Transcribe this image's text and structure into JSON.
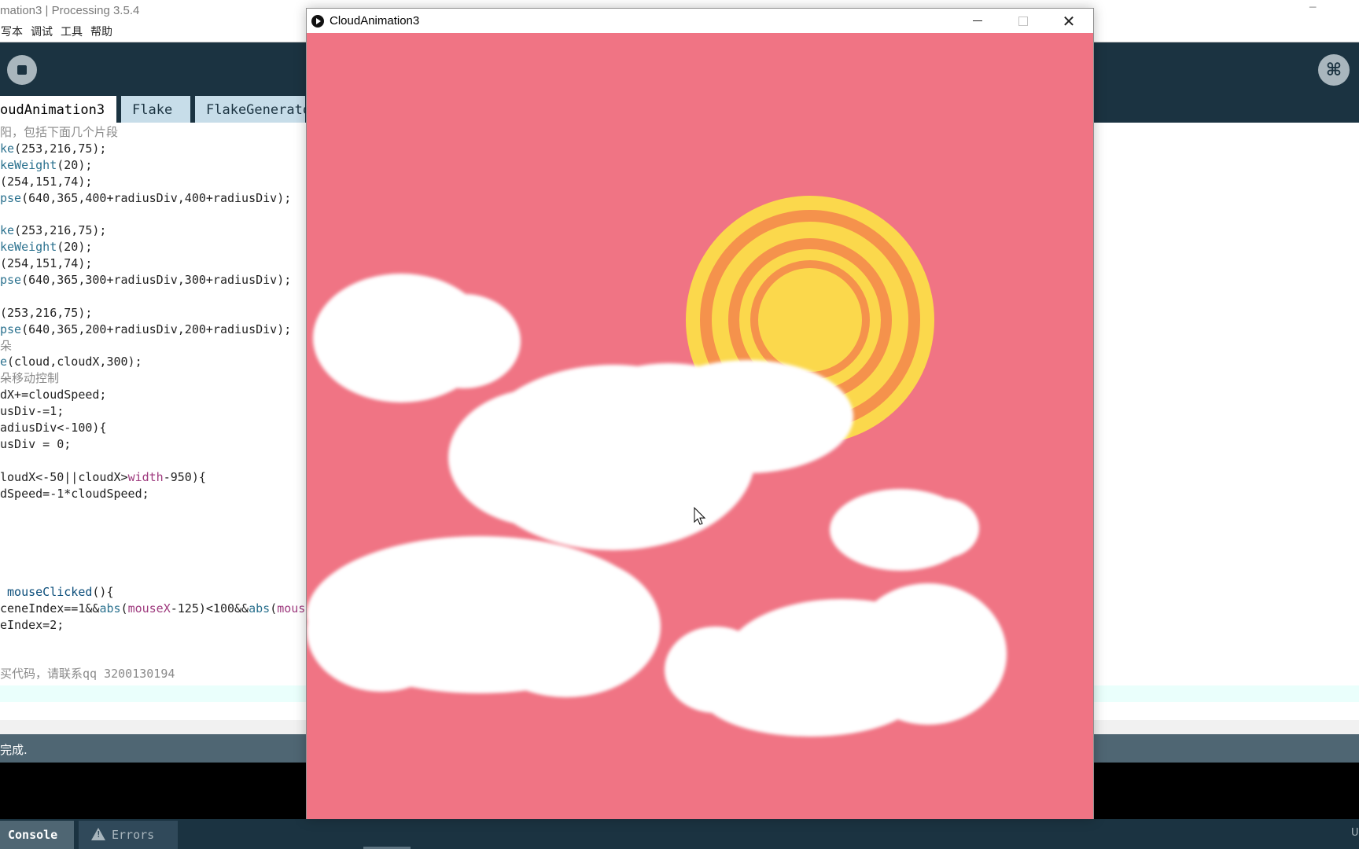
{
  "ide": {
    "window_title": "mation3 | Processing 3.5.4",
    "menu": [
      "写本",
      "调试",
      "工具",
      "帮助"
    ],
    "tabs": [
      "oudAnimation3",
      "Flake",
      "FlakeGenerato"
    ],
    "code_lines": [
      [
        "cm:阳，包括下面几个片段"
      ],
      [
        "fn:ke",
        "t:(253,216,75);"
      ],
      [
        "fn:keWeight",
        "t:(20);"
      ],
      [
        "t:(254,151,74);"
      ],
      [
        "fn:pse",
        "t:(640,365,400+radiusDiv,400+radiusDiv);"
      ],
      [],
      [
        "fn:ke",
        "t:(253,216,75);"
      ],
      [
        "fn:keWeight",
        "t:(20);"
      ],
      [
        "t:(254,151,74);"
      ],
      [
        "fn:pse",
        "t:(640,365,300+radiusDiv,300+radiusDiv);"
      ],
      [],
      [
        "t:(253,216,75);"
      ],
      [
        "fn:pse",
        "t:(640,365,200+radiusDiv,200+radiusDiv);"
      ],
      [
        "cm:朵"
      ],
      [
        "fn:e",
        "t:(cloud,cloudX,300);"
      ],
      [
        "cm:朵移动控制"
      ],
      [
        "t:dX+=cloudSpeed;"
      ],
      [
        "t:usDiv-=1;"
      ],
      [
        "t:adiusDiv<-100){"
      ],
      [
        "t:usDiv = 0;"
      ],
      [],
      [
        "t:loudX<-50||cloudX>",
        "kw:width",
        "t:-950){"
      ],
      [
        "t:dSpeed=-1*cloudSpeed;"
      ],
      [],
      [],
      [],
      [],
      [],
      [
        "md: mouseClicked",
        "t:(){"
      ],
      [
        "t:ceneIndex==1&&",
        "fn:abs",
        "t:(",
        "kw:mouseX",
        "t:-125)<100&&",
        "fn:abs",
        "t:(",
        "kw:mous"
      ],
      [
        "t:eIndex=2;"
      ],
      [],
      [],
      [
        "cm:买代码，请联系qq 3200130194"
      ]
    ],
    "status": "完成.",
    "console_tab": "Console",
    "errors_tab": "Errors",
    "bottom_right": "U"
  },
  "sketch": {
    "window_title": "CloudAnimation3",
    "min_label": "─",
    "close_label": "✕",
    "background_color": "#f07484",
    "sun_colors": [
      "#fbd84c",
      "#f5924c"
    ],
    "cloud_color": "#ffffff"
  }
}
